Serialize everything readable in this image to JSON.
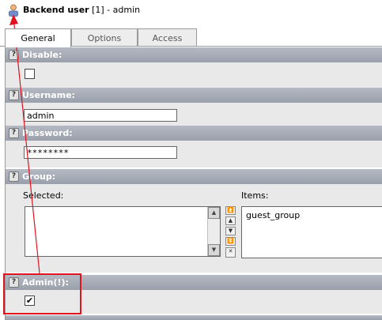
{
  "header": {
    "title_bold": "Backend user",
    "title_rest": " [1] - admin"
  },
  "tabs": [
    {
      "label": "General",
      "active": true
    },
    {
      "label": "Options",
      "active": false
    },
    {
      "label": "Access",
      "active": false
    }
  ],
  "sections": {
    "disable": {
      "label": "Disable:",
      "checked": false
    },
    "username": {
      "label": "Username:",
      "value": "admin"
    },
    "password": {
      "label": "Password:",
      "value": "********"
    },
    "group": {
      "label": "Group:",
      "selected_label": "Selected:",
      "items_label": "Items:",
      "items": [
        "guest_group"
      ]
    },
    "admin": {
      "label": "Admin(!):",
      "checked": true,
      "check_mark": "✔"
    }
  },
  "icons": {
    "help": "?",
    "scroll_up": "▲",
    "scroll_down": "▼",
    "move_top": "⏫",
    "move_up": "▲",
    "move_down": "▼",
    "move_bottom": "⏬",
    "remove": "✕"
  },
  "colors": {
    "section_header": "#a8adb7",
    "section_body": "#e9e9e9",
    "annotation": "#e0141e"
  }
}
